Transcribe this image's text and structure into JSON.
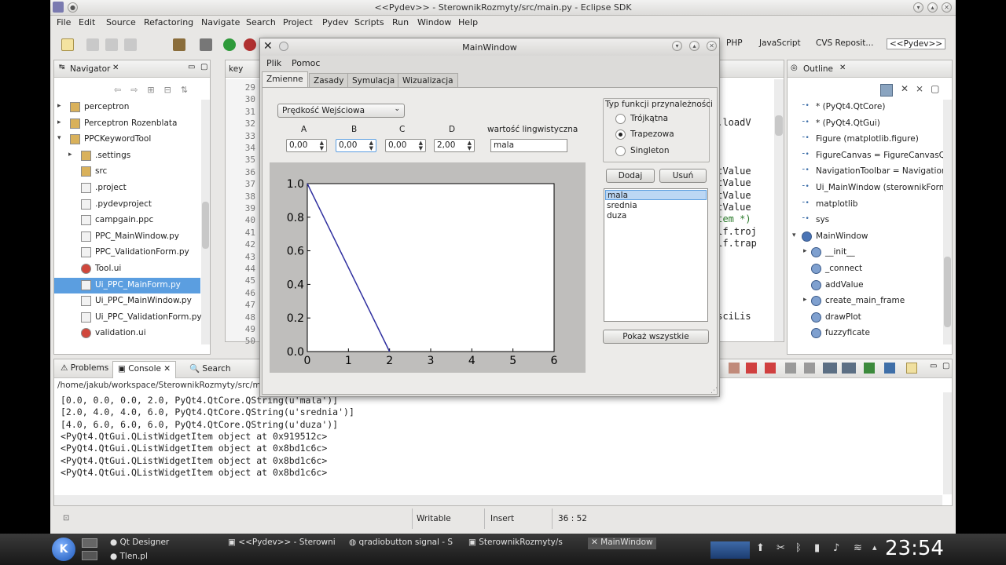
{
  "window": {
    "title": "<<Pydev>> - SterownikRozmyty/src/main.py - Eclipse SDK"
  },
  "menu": [
    "File",
    "Edit",
    "Source",
    "Refactoring",
    "Navigate",
    "Search",
    "Project",
    "Pydev",
    "Scripts",
    "Run",
    "Window",
    "Help"
  ],
  "perspectives": [
    "PHP",
    "JavaScript",
    "CVS Reposit...",
    "<<Pydev>>"
  ],
  "navigator": {
    "title": "Navigator",
    "items": [
      {
        "label": "perceptron",
        "icon": "folder-icon"
      },
      {
        "label": "Perceptron Rozenblata",
        "icon": "folder-icon"
      },
      {
        "label": "PPCKeywordTool",
        "icon": "folder-icon"
      },
      {
        "label": ".settings",
        "icon": "folder-icon"
      },
      {
        "label": "src",
        "icon": "folder-icon"
      },
      {
        "label": ".project",
        "icon": "file-icon"
      },
      {
        "label": ".pydevproject",
        "icon": "file-icon"
      },
      {
        "label": "campgain.ppc",
        "icon": "file-icon"
      },
      {
        "label": "PPC_MainWindow.py",
        "icon": "file-icon"
      },
      {
        "label": "PPC_ValidationForm.py",
        "icon": "file-icon"
      },
      {
        "label": "Tool.ui",
        "icon": "ui-icon"
      },
      {
        "label": "Ui_PPC_MainForm.py",
        "icon": "file-icon",
        "selected": true
      },
      {
        "label": "Ui_PPC_MainWindow.py",
        "icon": "file-icon"
      },
      {
        "label": "Ui_PPC_ValidationForm.py",
        "icon": "file-icon"
      },
      {
        "label": "validation.ui",
        "icon": "ui-icon"
      }
    ]
  },
  "editor": {
    "tab": "key",
    "line_numbers": [
      "29",
      "30",
      "31",
      "32",
      "33",
      "34",
      "35",
      "36",
      "37",
      "38",
      "39",
      "40",
      "41",
      "42",
      "43",
      "44",
      "45",
      "46",
      "47",
      "48",
      "49",
      "50"
    ],
    "code_fragments": [
      {
        "line": 3,
        "text": "f.loadV"
      },
      {
        "line": 7,
        "text": "otValue"
      },
      {
        "line": 8,
        "text": "otValue"
      },
      {
        "line": 9,
        "text": "otValue"
      },
      {
        "line": 10,
        "text": "otValue"
      },
      {
        "line": 11,
        "text": "Item *)"
      },
      {
        "line": 12,
        "text": "elf.troj"
      },
      {
        "line": 13,
        "text": "elf.trap"
      },
      {
        "line": 19,
        "text": "osciLis"
      }
    ]
  },
  "outline": {
    "title": "Outline",
    "items": [
      {
        "label": "* (PyQt4.QtCore)",
        "kind": "import"
      },
      {
        "label": "* (PyQt4.QtGui)",
        "kind": "import"
      },
      {
        "label": "Figure (matplotlib.figure)",
        "kind": "import"
      },
      {
        "label": "FigureCanvas = FigureCanvasQT",
        "kind": "import"
      },
      {
        "label": "NavigationToolbar = Navigation",
        "kind": "import"
      },
      {
        "label": "Ui_MainWindow (sterownikForm",
        "kind": "import"
      },
      {
        "label": "matplotlib",
        "kind": "import"
      },
      {
        "label": "sys",
        "kind": "import"
      },
      {
        "label": "MainWindow",
        "kind": "class"
      },
      {
        "label": "__init__",
        "kind": "method"
      },
      {
        "label": "_connect",
        "kind": "method"
      },
      {
        "label": "addValue",
        "kind": "method"
      },
      {
        "label": "create_main_frame",
        "kind": "method"
      },
      {
        "label": "drawPlot",
        "kind": "method"
      },
      {
        "label": "fuzzyficate",
        "kind": "method"
      }
    ]
  },
  "bottom": {
    "tabs": [
      "Problems",
      "Console",
      "Search"
    ],
    "console_path": "/home/jakub/workspace/SterownikRozmyty/src/m",
    "console_lines": [
      "[0.0, 0.0, 0.0, 2.0, PyQt4.QtCore.QString(u'mala')]",
      "[2.0, 4.0, 4.0, 6.0, PyQt4.QtCore.QString(u'srednia')]",
      "[4.0, 6.0, 6.0, 6.0, PyQt4.QtCore.QString(u'duza')]",
      "<PyQt4.QtGui.QListWidgetItem object at 0x919512c>",
      "<PyQt4.QtGui.QListWidgetItem object at 0x8bd1c6c>",
      "<PyQt4.QtGui.QListWidgetItem object at 0x8bd1c6c>",
      "<PyQt4.QtGui.QListWidgetItem object at 0x8bd1c6c>"
    ]
  },
  "status": {
    "mode": "Writable",
    "insert": "Insert",
    "pos": "36 : 52"
  },
  "dialog": {
    "title": "MainWindow",
    "menu": [
      "Plik",
      "Pomoc"
    ],
    "tabs": [
      "Zmienne",
      "Zasady",
      "Symulacja",
      "Wizualizacja"
    ],
    "variable_select": "Prędkość Wejściowa",
    "param_labels": [
      "A",
      "B",
      "C",
      "D"
    ],
    "param_values": [
      "0,00",
      "0,00",
      "0,00",
      "2,00"
    ],
    "ling_label": "wartość lingwistyczna",
    "ling_value": "mala",
    "group_title": "Typ funkcji przynależności",
    "radio_options": [
      "Trójkątna",
      "Trapezowa",
      "Singleton"
    ],
    "radio_selected": 1,
    "add_button": "Dodaj",
    "remove_button": "Usuń",
    "list_items": [
      "mala",
      "srednia",
      "duza"
    ],
    "list_selected": 0,
    "show_all_button": "Pokaż wszystkie"
  },
  "chart_data": {
    "type": "line",
    "series": [
      {
        "x": [
          0,
          2
        ],
        "y": [
          1.0,
          0.0
        ],
        "color": "#3030a0"
      }
    ],
    "xlim": [
      0,
      6
    ],
    "ylim": [
      0,
      1
    ],
    "x_ticks": [
      "0",
      "1",
      "2",
      "3",
      "4",
      "5",
      "6"
    ],
    "y_ticks": [
      "0.0",
      "0.2",
      "0.4",
      "0.6",
      "0.8",
      "1.0"
    ]
  },
  "taskbar": {
    "tasks": [
      "Qt Designer",
      "Tlen.pl",
      "<<Pydev>> - Sterowni",
      "qradiobutton signal - S",
      "SterownikRozmyty/s",
      "MainWindow"
    ],
    "clock": "23:54"
  },
  "colors": {
    "selection": "#5b9ee0",
    "plot_line": "#3030a0"
  }
}
